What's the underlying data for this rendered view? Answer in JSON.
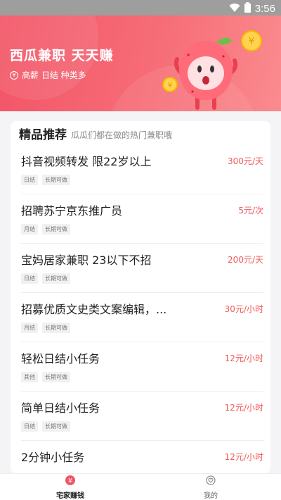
{
  "status_bar": {
    "time": "3:56"
  },
  "hero": {
    "title": "西瓜兼职 天天赚",
    "subtitle": "高薪 日结 种类多",
    "coin_symbol": "¥"
  },
  "section": {
    "title": "精品推荐",
    "subtitle": "瓜瓜们都在做的热门兼职哦"
  },
  "jobs": [
    {
      "title": "抖音视频转发 限22岁以上",
      "pay": "300元/天",
      "tags": [
        "日结",
        "长期可做"
      ]
    },
    {
      "title": "招聘苏宁京东推广员",
      "pay": "5元/次",
      "tags": [
        "月结",
        "长期可做"
      ]
    },
    {
      "title": "宝妈居家兼职 23以下不招",
      "pay": "200元/天",
      "tags": [
        "日结",
        "长期可做"
      ]
    },
    {
      "title": "招募优质文史类文案编辑，...",
      "pay": "30元/小时",
      "tags": [
        "月结",
        "长期可做"
      ]
    },
    {
      "title": "轻松日结小任务",
      "pay": "12元/小时",
      "tags": [
        "其他",
        "长期可做"
      ]
    },
    {
      "title": "简单日结小任务",
      "pay": "12元/小时",
      "tags": [
        "日结",
        "长期可做"
      ]
    },
    {
      "title": "2分钟小任务",
      "pay": "12元/小时",
      "tags": []
    }
  ],
  "tabbar": {
    "tabs": [
      {
        "label": "宅家赚钱",
        "icon": "yen-coin-icon",
        "active": true
      },
      {
        "label": "我的",
        "icon": "heart-icon",
        "active": false
      }
    ]
  },
  "colors": {
    "brand": "#f25567",
    "pay": "#f15a5a"
  }
}
